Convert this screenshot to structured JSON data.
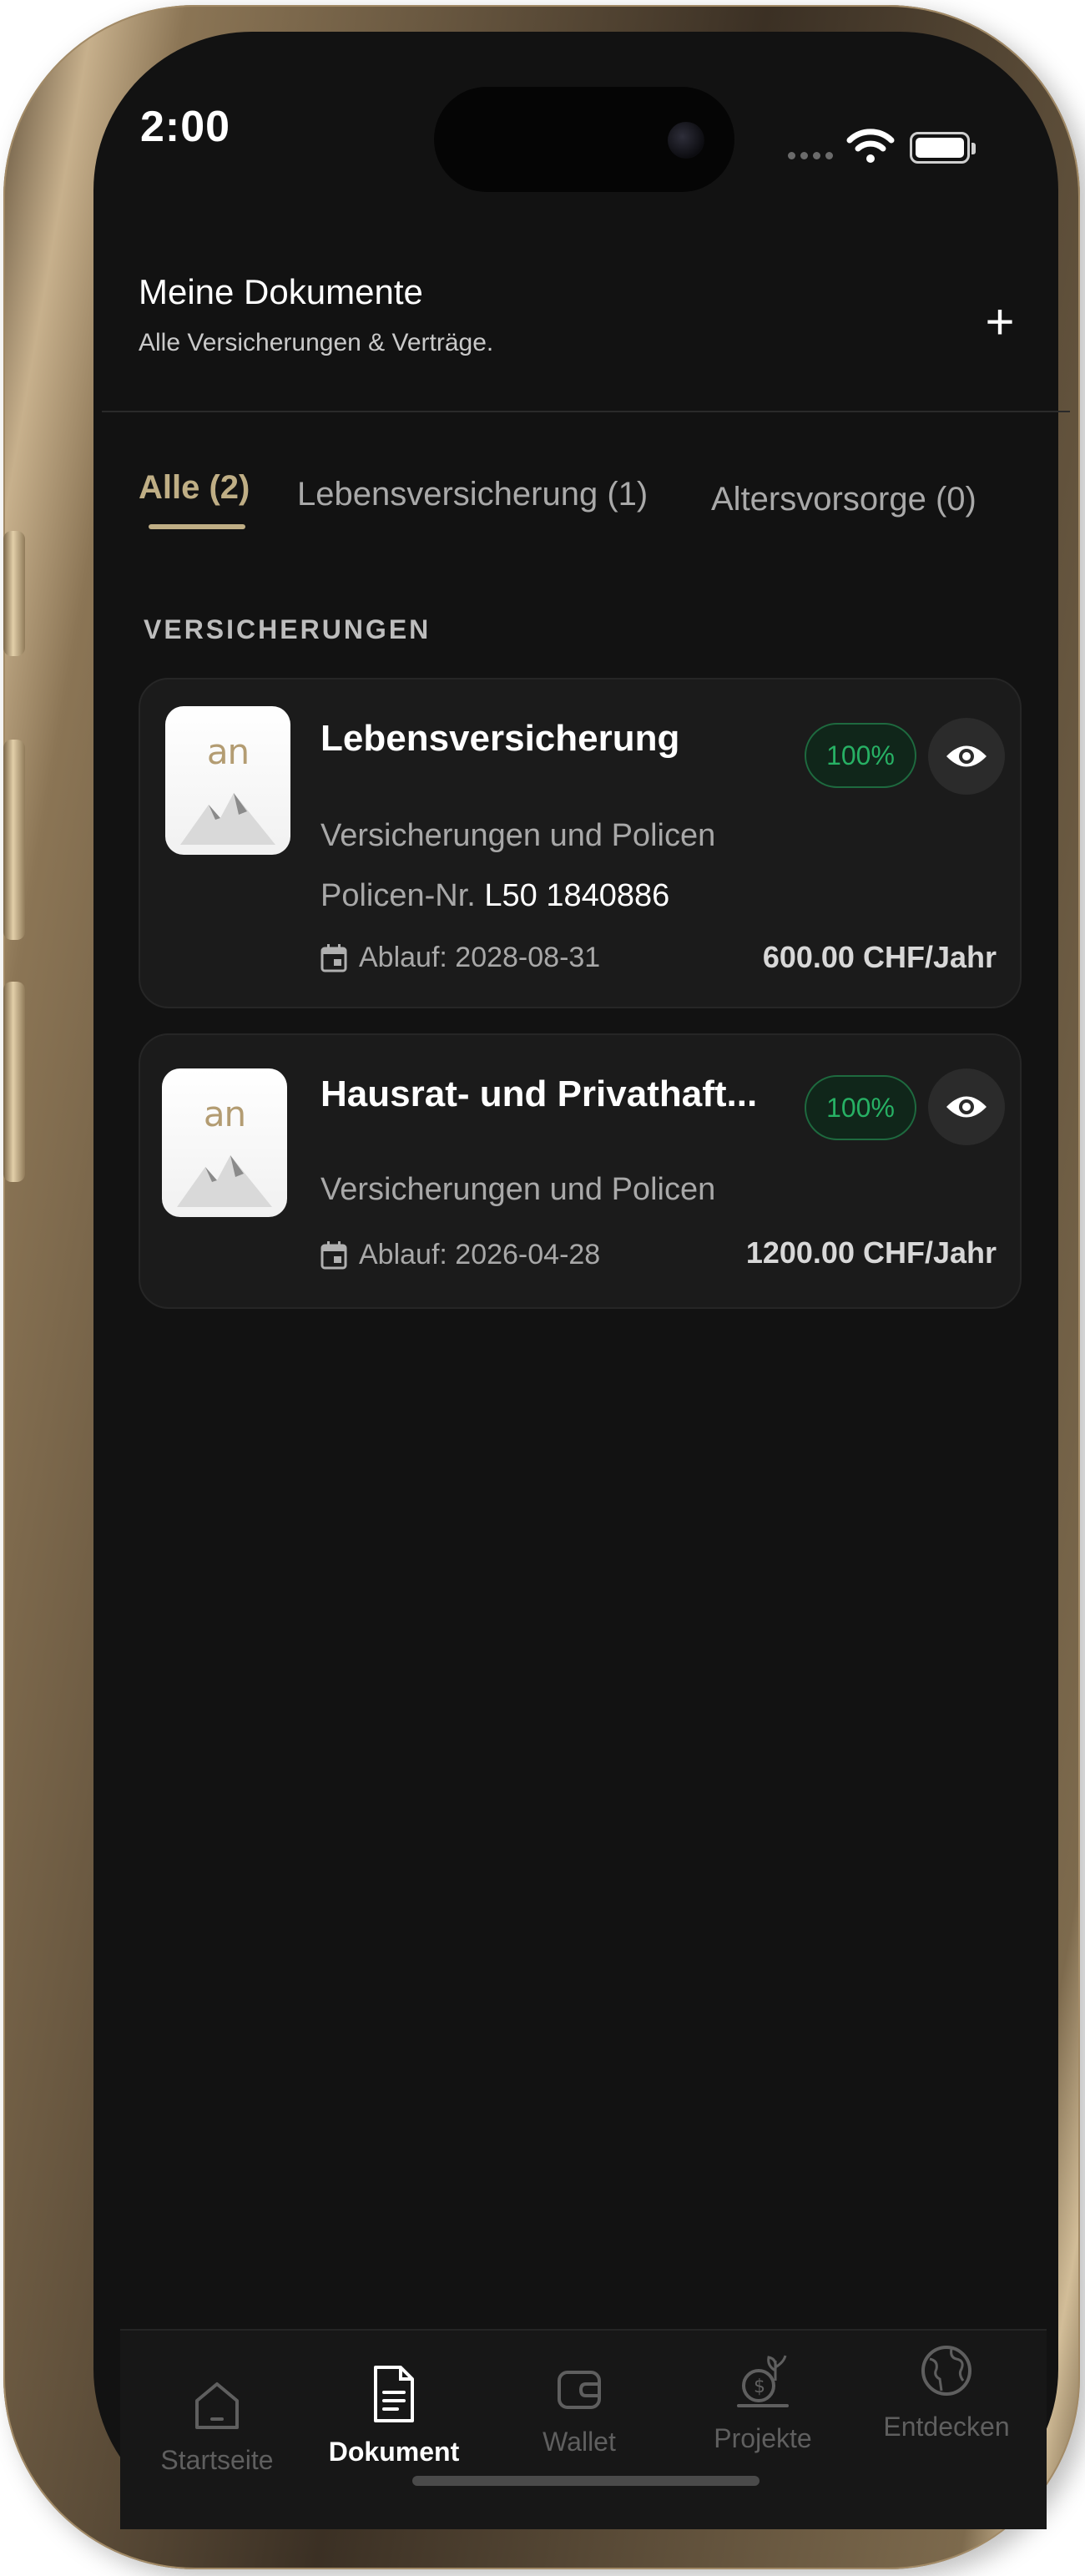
{
  "status_bar": {
    "time": "2:00"
  },
  "header": {
    "title": "Meine Dokumente",
    "subtitle": "Alle Versicherungen & Verträge.",
    "add_icon": "plus-icon"
  },
  "tabs": [
    {
      "label": "Alle (2)",
      "active": true
    },
    {
      "label": "Lebensversicherung (1)",
      "active": false
    },
    {
      "label": "Altersvorsorge (0)",
      "active": false
    }
  ],
  "section_title": "VERSICHERUNGEN",
  "documents": [
    {
      "logo_text": "an",
      "title": "Lebensversicherung",
      "category": "Versicherungen und Policen",
      "policy_label": "Policen-Nr.",
      "policy_number": "L50 1840886",
      "badge": "100%",
      "due": "Ablauf: 2028-08-31",
      "price": "600.00 CHF/Jahr"
    },
    {
      "logo_text": "an",
      "title": "Hausrat- und Privathaft...",
      "category": "Versicherungen und Policen",
      "badge": "100%",
      "due": "Ablauf: 2026-04-28",
      "price": "1200.00 CHF/Jahr"
    }
  ],
  "nav": [
    {
      "label": "Startseite",
      "icon": "home-icon",
      "active": false
    },
    {
      "label": "Dokument",
      "icon": "document-icon",
      "active": true
    },
    {
      "label": "Wallet",
      "icon": "wallet-icon",
      "active": false
    },
    {
      "label": "Projekte",
      "icon": "projects-icon",
      "active": false
    },
    {
      "label": "Entdecken",
      "icon": "globe-icon",
      "active": false
    }
  ],
  "colors": {
    "accent": "#bfae85",
    "badge_green": "#27b064",
    "background": "#121212",
    "card": "#1b1b1b"
  }
}
